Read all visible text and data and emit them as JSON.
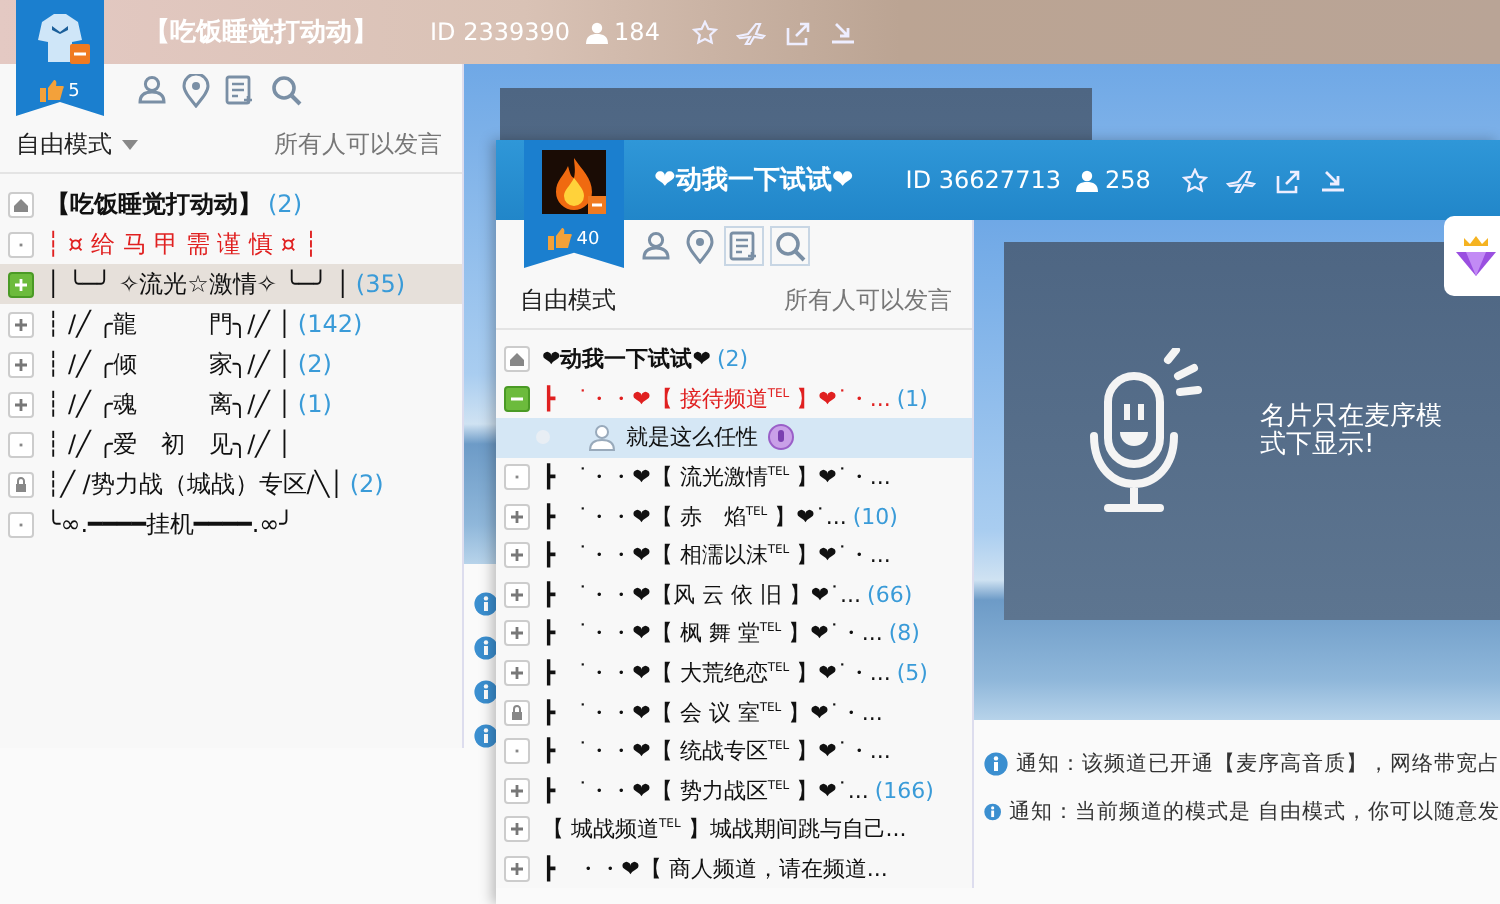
{
  "back_window": {
    "title": "【吃饭睡觉打动动】",
    "channel_id": "ID 2339390",
    "members": "184",
    "likes": "5",
    "mode": "自由模式",
    "dropdown": true,
    "speak_permission": "所有人可以发言",
    "channels": [
      {
        "kind": "home",
        "name": "【吃饭睡觉打动动】",
        "count": "(2)",
        "color": "#111111",
        "current": false,
        "expanded": false,
        "selected": false
      },
      {
        "kind": "room",
        "name": "┆ ¤ 给 马 甲 需 谨 慎 ¤ ┆",
        "color": "#e02020",
        "current": false,
        "expanded": false,
        "selected": false
      },
      {
        "kind": "group",
        "name": "│ ╰─╯ ✧流光☆激情✧ ╰─╯ │",
        "count": "(35)",
        "color": "#111111",
        "current": true,
        "expanded": false,
        "selected": true
      },
      {
        "kind": "group",
        "name": "┆ /╱ ╭龍　　　門╮/╱ │",
        "count": "(142)",
        "color": "#111111",
        "current": false,
        "expanded": false,
        "selected": false
      },
      {
        "kind": "group",
        "name": "┆ /╱ ╭倾　　　家╮/╱ │",
        "count": "(2)",
        "color": "#111111",
        "current": false,
        "expanded": false,
        "selected": false
      },
      {
        "kind": "group",
        "name": "┆ /╱ ╭魂　　　离╮/╱ │",
        "count": "(1)",
        "color": "#111111",
        "current": false,
        "expanded": false,
        "selected": false
      },
      {
        "kind": "room",
        "name": "┆ /╱ ╭爱　初　见╮/╱ │",
        "color": "#111111",
        "current": false,
        "expanded": false,
        "selected": false
      },
      {
        "kind": "locked",
        "name": "┆╱ /势力战（城战）专区/╲│",
        "count": "(2)",
        "color": "#111111",
        "current": false,
        "expanded": false,
        "selected": false
      },
      {
        "kind": "room",
        "name": "╰∞.━━━━挂机━━━━.∞╯",
        "color": "#111111",
        "current": false,
        "expanded": false,
        "selected": false
      }
    ]
  },
  "front_window": {
    "title": "❤动我一下试试❤",
    "channel_id": "ID 36627713",
    "members": "258",
    "likes": "40",
    "mode": "自由模式",
    "speak_permission": "所有人可以发言",
    "channels": [
      {
        "kind": "home",
        "name": "❤动我一下试试❤",
        "count": "(2)",
        "color": "#111111",
        "current": false,
        "expanded": false,
        "selected": false
      },
      {
        "kind": "group",
        "name": "┣　˙・・❤【 接待频道$^{TEL}$ 】❤˙・...",
        "count": "(1)",
        "color": "#e02020",
        "current": true,
        "expanded": true,
        "selected": false,
        "members": [
          {
            "name": "就是这么任性",
            "selected": true
          }
        ]
      },
      {
        "kind": "room",
        "name": "┣　˙・・❤【 流光激情$^{TEL}$ 】❤˙・...",
        "color": "#111111",
        "current": false,
        "expanded": false,
        "selected": false
      },
      {
        "kind": "group",
        "name": "┣　˙・・❤【 赤　焰$^{TEL}$ 】❤˙...",
        "count": "(10)",
        "color": "#111111",
        "current": false,
        "expanded": false,
        "selected": false
      },
      {
        "kind": "group",
        "name": "┣　˙・・❤【 相濡以沫$^{TEL}$ 】❤˙・...",
        "color": "#111111",
        "current": false,
        "expanded": false,
        "selected": false
      },
      {
        "kind": "group",
        "name": "┣　˙・・❤【风 云 依 旧 】❤˙...",
        "count": "(66)",
        "color": "#111111",
        "current": false,
        "expanded": false,
        "selected": false
      },
      {
        "kind": "group",
        "name": "┣　˙・・❤【 枫 舞 堂$^{TEL}$ 】❤˙・...",
        "count": "(8)",
        "color": "#111111",
        "current": false,
        "expanded": false,
        "selected": false
      },
      {
        "kind": "group",
        "name": "┣　˙・・❤【 大荒绝恋$^{TEL}$ 】❤˙・...",
        "count": "(5)",
        "color": "#111111",
        "current": false,
        "expanded": false,
        "selected": false
      },
      {
        "kind": "locked",
        "name": "┣　˙・・❤【 会 议 室$^{TEL}$ 】❤˙・...",
        "color": "#111111",
        "current": false,
        "expanded": false,
        "selected": false
      },
      {
        "kind": "room",
        "name": "┣　˙・・❤【 统战专区$^{TEL}$ 】❤˙・...",
        "color": "#111111",
        "current": false,
        "expanded": false,
        "selected": false
      },
      {
        "kind": "group",
        "name": "┣　˙・・❤【 势力战区$^{TEL}$ 】❤˙...",
        "count": "(166)",
        "color": "#111111",
        "current": false,
        "expanded": false,
        "selected": false
      },
      {
        "kind": "group",
        "name": "【 城战频道$^{TEL}$ 】城战期间跳与自己...",
        "color": "#111111",
        "current": false,
        "expanded": false,
        "selected": false
      },
      {
        "kind": "group",
        "name": "┣　・・❤【 商人频道，请在频道...",
        "color": "#111111",
        "current": false,
        "expanded": false,
        "selected": false
      }
    ],
    "card_message": "名片只在麦序模式下显示!",
    "notices": [
      "通知：该频道已开通【麦序高音质】，网络带宽占",
      "通知：当前频道的模式是 自由模式，你可以随意发"
    ]
  }
}
